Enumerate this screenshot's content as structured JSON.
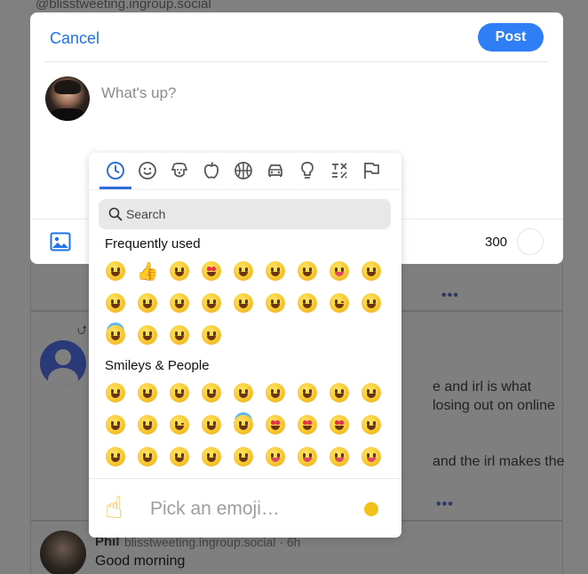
{
  "background": {
    "handle": "@blisstweeting.ingroup.social",
    "more_dots": "•••",
    "repost_glyph": "⮍",
    "post2_fragments": [
      "e and irl is what",
      "losing out on online",
      "and the irl makes the"
    ],
    "post3": {
      "author": "Phil",
      "meta": "blisstweeting.ingroup.social · 6h",
      "text": "Good morning"
    }
  },
  "composer": {
    "cancel_label": "Cancel",
    "post_label": "Post",
    "placeholder": "What's up?",
    "char_count": "300",
    "colors": {
      "accent": "#2f7ef5",
      "link": "#1e73e8"
    }
  },
  "emoji_picker": {
    "categories": [
      "clock-icon",
      "smiley-icon",
      "dog-icon",
      "apple-icon",
      "basketball-icon",
      "car-icon",
      "lightbulb-icon",
      "symbols-icon",
      "flag-icon"
    ],
    "active_category": "clock-icon",
    "search_placeholder": "Search",
    "sections": [
      {
        "title": "Frequently used",
        "emojis": [
          "grinning-face",
          "thumbs-up",
          "kissing-heart",
          "heart-eyes",
          "laughing",
          "hugging",
          "relaxed",
          "winking-tongue",
          "screaming",
          "smile",
          "sweat-smile",
          "hand-over-mouth",
          "grin",
          "joy",
          "kissing-smile",
          "melting",
          "wink",
          "shushing",
          "halo",
          "kissing-closed-eyes",
          "smiley",
          "holding-tears"
        ]
      },
      {
        "title": "Smileys & People",
        "emojis": [
          "grinning-face",
          "smiley",
          "smile",
          "grin",
          "laughing",
          "sweat-smile",
          "rofl",
          "joy",
          "slight-smile",
          "upside-down",
          "melting",
          "wink",
          "blush",
          "halo",
          "smiling-hearts",
          "heart-eyes",
          "star-struck",
          "kissing-heart",
          "kissing",
          "relaxed",
          "kissing-closed-eyes",
          "kissing-smile",
          "holding-tears",
          "yum",
          "tongue",
          "winking-tongue",
          "zany"
        ]
      }
    ],
    "preview_emoji": "☝",
    "preview_label": "Pick an emoji…",
    "skin_tone_color": "#f3c21a"
  }
}
